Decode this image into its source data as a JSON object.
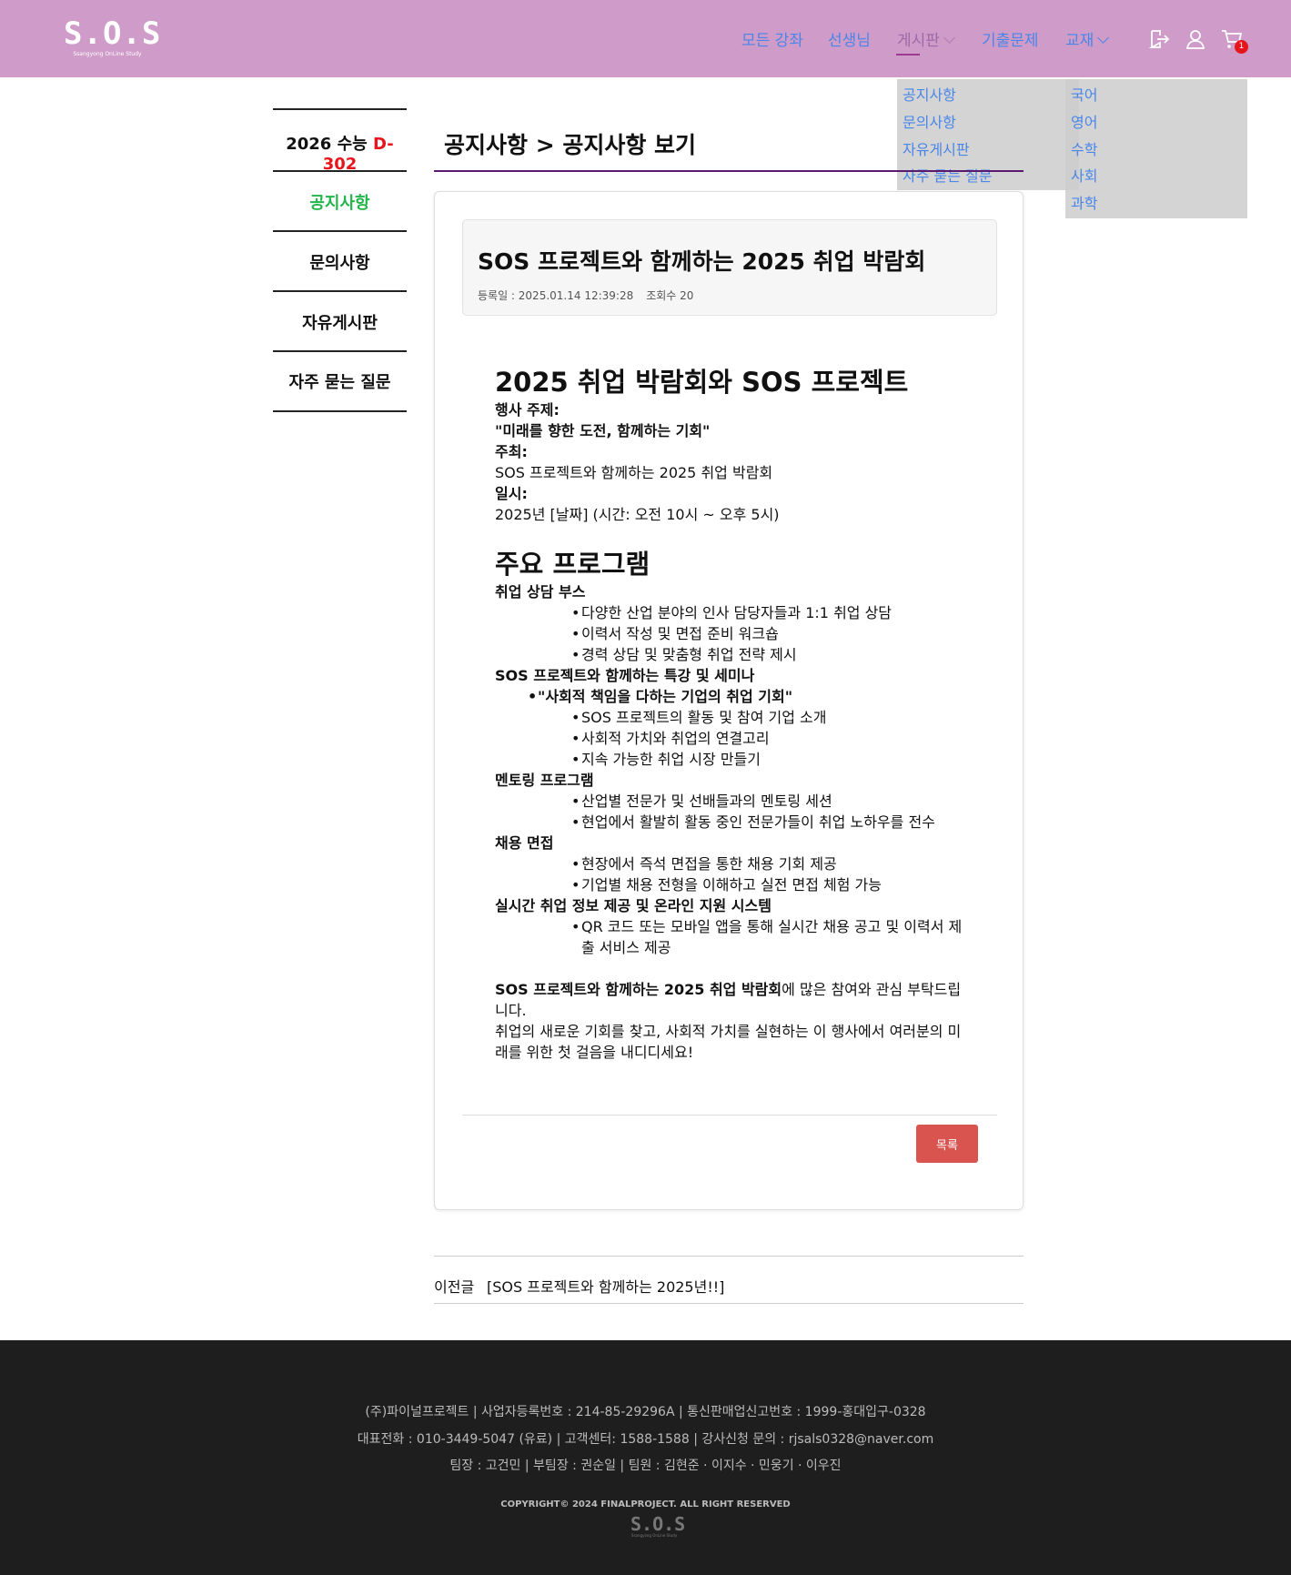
{
  "header": {
    "logo_text": "S.O.S",
    "logo_sub": "Ssangyong OnLine Study",
    "nav": [
      "모든 강좌",
      "선생님",
      "게시판",
      "기출문제",
      "교재"
    ],
    "cart_count": "1"
  },
  "dropdown_board": [
    "공지사항",
    "문의사항",
    "자유게시판",
    "자주 묻는 질문"
  ],
  "dropdown_books": [
    "국어",
    "영어",
    "수학",
    "사회",
    "과학"
  ],
  "sidebar": {
    "dday_prefix": "2026 수능 ",
    "dday_value": "D-302",
    "items": [
      "공지사항",
      "문의사항",
      "자유게시판",
      "자주 묻는 질문"
    ]
  },
  "page_title": "공지사항 > 공지사항 보기",
  "post": {
    "title": "SOS 프로젝트와 함께하는 2025 취업 박람회",
    "date_label": "등록일 : 2025.01.14 12:39:28",
    "views_label": "조회수 20"
  },
  "content": {
    "h1": "2025 취업 박람회와 SOS 프로젝트",
    "theme_label": "행사 주제:",
    "theme_value": "\"미래를 향한 도전, 함께하는 기회\"",
    "host_label": "주최:",
    "host_value": "SOS 프로젝트와 함께하는 2025 취업 박람회",
    "date_label": "일시:",
    "date_value": "2025년 [날짜] (시간: 오전 10시 ~ 오후 5시)",
    "h2": "주요 프로그램",
    "sec1": "취업 상담 부스",
    "sec1_items": [
      "다양한 산업 분야의 인사 담당자들과 1:1 취업 상담",
      "이력서 작성 및 면접 준비 워크숍",
      "경력 상담 및 맞춤형 취업 전략 제시"
    ],
    "sec2": "SOS 프로젝트와 함께하는 특강 및 세미나",
    "sec2_sub": "\"사회적 책임을 다하는 기업의 취업 기회\"",
    "sec2_items": [
      "SOS 프로젝트의 활동 및 참여 기업 소개",
      "사회적 가치와 취업의 연결고리",
      "지속 가능한 취업 시장 만들기"
    ],
    "sec3": "멘토링 프로그램",
    "sec3_items": [
      "산업별 전문가 및 선배들과의 멘토링 세션",
      "현업에서 활발히 활동 중인 전문가들이 취업 노하우를 전수"
    ],
    "sec4": "채용 면접",
    "sec4_items": [
      "현장에서 즉석 면접을 통한 채용 기회 제공",
      "기업별 채용 전형을 이해하고 실전 면접 체험 가능"
    ],
    "sec5": "실시간 취업 정보 제공 및 온라인 지원 시스템",
    "sec5_items": [
      "QR 코드 또는 모바일 앱을 통해 실시간 채용 공고 및 이력서 제출 서비스 제공"
    ],
    "closing_bold": "SOS 프로젝트와 함께하는 2025 취업 박람회",
    "closing_rest": "에 많은 참여와 관심 부탁드립니다.",
    "closing_2": "취업의 새로운 기회를 찾고, 사회적 가치를 실현하는 이 행사에서 여러분의 미래를 위한 첫 걸음을 내디디세요!"
  },
  "list_button": "목록",
  "prev": {
    "label": "이전글",
    "link": "[SOS 프로젝트와 함께하는 2025년!!]"
  },
  "footer": {
    "line1": "(주)파이널프로젝트 | 사업자등록번호 : 214-85-29296A | 통신판매업신고번호 : 1999-홍대입구-0328",
    "line2": "대표전화 : 010-3449-5047 (유료) | 고객센터: 1588-1588 | 강사신청 문의 : rjsals0328@naver.com",
    "line3": "팀장 : 고건민  |  부팀장 : 권순일  |  팀원 : 김현준 · 이지수 · 민웅기 · 이우진",
    "copyright": "COPYRIGHT© 2024 FINALPROJECT. ALL RIGHT RESERVED",
    "logo_text": "S.O.S",
    "logo_sub": "Ssangyong OnLine Study"
  },
  "colors": {
    "header_bg": "#cf9bc8",
    "nav_link": "#4a86e8",
    "active_green": "#23b44a",
    "dday_red": "#e8141b",
    "button_red": "#d9534f",
    "footer_bg": "#1e1e1e"
  },
  "icons": [
    "logout-icon",
    "user-icon",
    "cart-icon"
  ]
}
